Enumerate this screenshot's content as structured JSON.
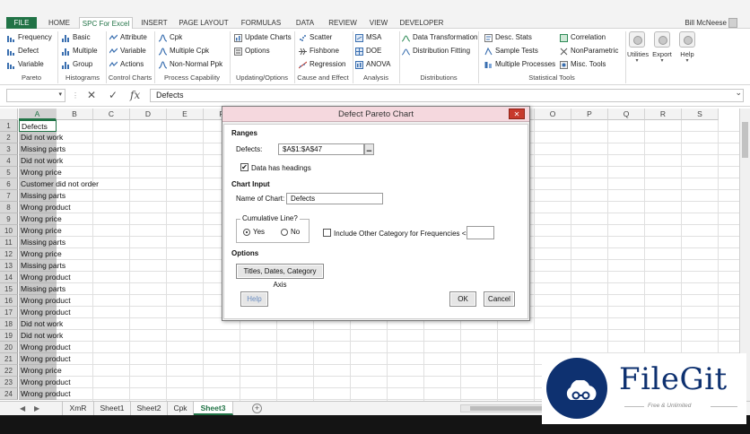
{
  "ribbon_tabs": [
    "FILE",
    "HOME",
    "SPC For Excel",
    "INSERT",
    "PAGE LAYOUT",
    "FORMULAS",
    "DATA",
    "REVIEW",
    "VIEW",
    "DEVELOPER"
  ],
  "active_tab": "SPC For Excel",
  "user_name": "Bill McNeese",
  "ribbon": {
    "pareto": {
      "label": "Pareto",
      "items": [
        "Frequency",
        "Defect",
        "Variable"
      ]
    },
    "histograms": {
      "label": "Histograms",
      "items": [
        "Basic",
        "Multiple",
        "Group"
      ]
    },
    "control_charts": {
      "label": "Control Charts",
      "items": [
        "Attribute",
        "Variable",
        "Actions"
      ]
    },
    "process_capability": {
      "label": "Process Capability",
      "items": [
        "Cpk",
        "Multiple Cpk",
        "Non-Normal Ppk"
      ]
    },
    "updating_options": {
      "label": "Updating/Options",
      "items": [
        "Update Charts",
        "Options"
      ]
    },
    "cause_effect": {
      "label": "Cause and Effect",
      "items": [
        "Scatter",
        "Fishbone",
        "Regression"
      ]
    },
    "analysis": {
      "label": "Analysis",
      "items": [
        "MSA",
        "DOE",
        "ANOVA"
      ]
    },
    "distributions": {
      "label": "Distributions",
      "items": [
        "Data Transformation",
        "Distribution Fitting"
      ]
    },
    "statistical_tools": {
      "label": "Statistical Tools",
      "items": [
        "Desc. Stats",
        "Sample Tests",
        "Multiple Processes",
        "Correlation",
        "NonParametric",
        "Misc. Tools"
      ]
    },
    "big_buttons": [
      "Utilities",
      "Export",
      "Help"
    ]
  },
  "formula_bar": {
    "name_box": "",
    "content": "Defects",
    "cancel_symbol": "✕",
    "enter_symbol": "✓",
    "fx_symbol": "fx"
  },
  "columns": [
    "A",
    "B",
    "C",
    "D",
    "E",
    "F",
    "G",
    "H",
    "I",
    "J",
    "K",
    "L",
    "M",
    "N",
    "O",
    "P",
    "Q",
    "R",
    "S"
  ],
  "rows": [
    {
      "num": "1",
      "a": "Defects"
    },
    {
      "num": "2",
      "a": "Did not work"
    },
    {
      "num": "3",
      "a": "Missing parts"
    },
    {
      "num": "4",
      "a": "Did not work"
    },
    {
      "num": "5",
      "a": "Wrong price"
    },
    {
      "num": "6",
      "a": "Customer did not order"
    },
    {
      "num": "7",
      "a": "Missing parts"
    },
    {
      "num": "8",
      "a": "Wrong product"
    },
    {
      "num": "9",
      "a": "Wrong price"
    },
    {
      "num": "10",
      "a": "Wrong price"
    },
    {
      "num": "11",
      "a": "Missing parts"
    },
    {
      "num": "12",
      "a": "Wrong price"
    },
    {
      "num": "13",
      "a": "Missing parts"
    },
    {
      "num": "14",
      "a": "Wrong product"
    },
    {
      "num": "15",
      "a": "Missing parts"
    },
    {
      "num": "16",
      "a": "Wrong product"
    },
    {
      "num": "17",
      "a": "Wrong product"
    },
    {
      "num": "18",
      "a": "Did not work"
    },
    {
      "num": "19",
      "a": "Did not work"
    },
    {
      "num": "20",
      "a": "Wrong product"
    },
    {
      "num": "21",
      "a": "Wrong product"
    },
    {
      "num": "22",
      "a": "Wrong price"
    },
    {
      "num": "23",
      "a": "Wrong product"
    },
    {
      "num": "24",
      "a": "Wrong product"
    }
  ],
  "sheet_tabs": [
    "XmR",
    "Sheet1",
    "Sheet2",
    "Cpk",
    "Sheet3"
  ],
  "active_sheet": "Sheet3",
  "dialog": {
    "title": "Defect Pareto Chart",
    "close_symbol": "✕",
    "ranges_heading": "Ranges",
    "defects_label": "Defects:",
    "defects_value": "$A$1:$A$47",
    "has_headings_label": "Data has headings",
    "has_headings_checked": true,
    "chart_input_heading": "Chart Input",
    "chart_name_label": "Name of Chart:",
    "chart_name_value": "Defects",
    "cumulative_legend": "Cumulative Line?",
    "yes_label": "Yes",
    "no_label": "No",
    "cumulative_selected": "Yes",
    "include_other_label": "Include Other Category for Frequencies <=:",
    "include_other_checked": false,
    "include_other_value": "",
    "options_heading": "Options",
    "titles_button": "Titles, Dates, Category Axis",
    "help_button": "Help",
    "ok_button": "OK",
    "cancel_button": "Cancel"
  },
  "watermark": {
    "name": "FileGit",
    "tagline": "Free & Unlimited"
  },
  "colors": {
    "excel_green": "#217346",
    "dialog_title_bg": "#f5d8de",
    "watermark_navy": "#0e3170"
  }
}
